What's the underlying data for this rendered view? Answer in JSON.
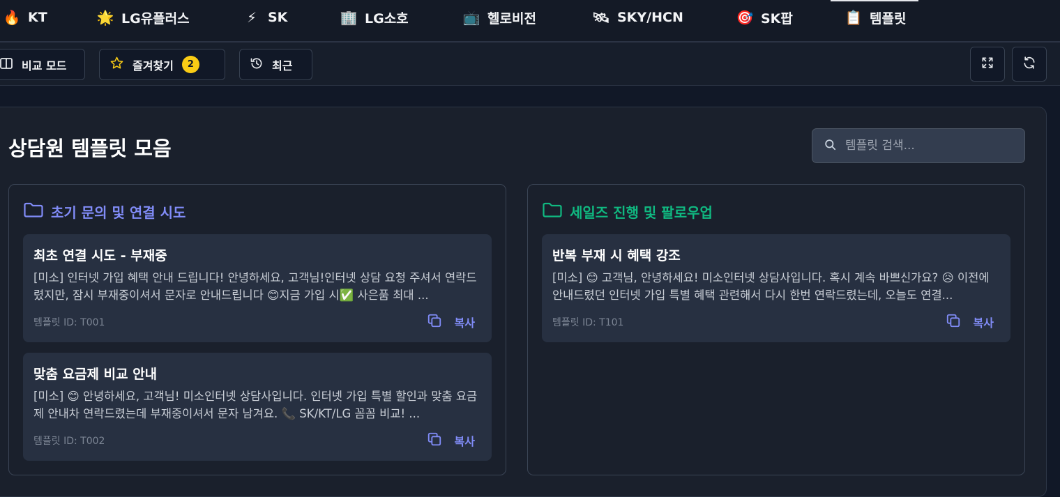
{
  "tabs": [
    {
      "icon": "🔥",
      "icon_name": "fire-icon",
      "label": "KT"
    },
    {
      "icon": "🌟",
      "icon_name": "star-icon",
      "label": "LG유플러스"
    },
    {
      "icon": "⚡",
      "icon_name": "lightning-icon",
      "label": "SK"
    },
    {
      "icon": "🏢",
      "icon_name": "building-icon",
      "label": "LG소호"
    },
    {
      "icon": "📺",
      "icon_name": "tv-icon",
      "label": "헬로비전"
    },
    {
      "icon": "🛰",
      "icon_name": "satellite-icon",
      "label": "SKY/HCN"
    },
    {
      "icon": "🎯",
      "icon_name": "target-icon",
      "label": "SK팝"
    },
    {
      "icon": "📋",
      "icon_name": "clipboard-icon",
      "label": "템플릿"
    }
  ],
  "active_tab": "템플릿",
  "toolbar": {
    "compare_label": "비교 모드",
    "favorites_label": "즐겨찾기",
    "favorites_count": "2",
    "recent_label": "최근"
  },
  "main": {
    "title": "상담원 템플릿 모음",
    "search_placeholder": "템플릿 검색..."
  },
  "colors": {
    "group1_accent": "#818cf8",
    "group2_accent": "#10b981",
    "copy_accent": "#818cf8",
    "badge": "#facc15"
  },
  "groups": [
    {
      "title": "초기 문의 및 연결 시도",
      "templates": [
        {
          "title": "최초 연결 시도 - 부재중",
          "body": "[미소] 인터넷 가입 혜택 안내 드립니다! 안녕하세요, 고객님!인터넷 상담 요청 주셔서 연락드렸지만, 잠시 부재중이셔서 문자로 안내드립니다 😊지금 가입 시✅ 사은품 최대 ...",
          "id_text": "템플릿 ID: T001",
          "copy_label": "복사"
        },
        {
          "title": "맞춤 요금제 비교 안내",
          "body": "[미소] 😊 안녕하세요, 고객님! 미소인터넷 상담사입니다. 인터넷 가입 특별 할인과 맞춤 요금제 안내차 연락드렸는데 부재중이셔서 문자 남겨요. 📞 SK/KT/LG 꼼꼼 비교! ...",
          "id_text": "템플릿 ID: T002",
          "copy_label": "복사"
        }
      ]
    },
    {
      "title": "세일즈 진행 및 팔로우업",
      "templates": [
        {
          "title": "반복 부재 시 혜택 강조",
          "body": "[미소] 😊 고객님, 안녕하세요! 미소인터넷 상담사입니다. 혹시 계속 바쁘신가요? 😥 이전에 안내드렸던 인터넷 가입 특별 혜택 관련해서 다시 한번 연락드렸는데, 오늘도 연결...",
          "id_text": "템플릿 ID: T101",
          "copy_label": "복사"
        }
      ]
    }
  ]
}
